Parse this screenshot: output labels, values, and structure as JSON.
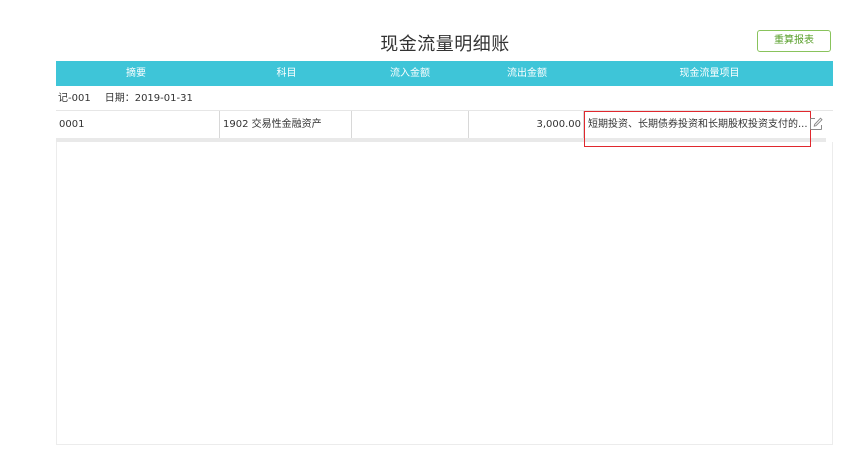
{
  "page": {
    "title": "现金流量明细账",
    "recalc_button": "重算报表"
  },
  "table": {
    "columns": [
      "摘要",
      "科目",
      "流入金额",
      "流出金额",
      "现金流量项目"
    ],
    "voucher": {
      "number": "记-001",
      "date": "日期：2019-01-31"
    },
    "rows": [
      {
        "summary": "0001",
        "account": "1902 交易性金融资产",
        "inflow": "",
        "outflow": "3,000.00",
        "cashflow_item": "短期投资、长期债券投资和长期股权投资支付的..."
      }
    ]
  },
  "icons": {
    "edit": "edit-icon"
  },
  "colors": {
    "header": "#3ec5d8",
    "button_border": "#89c35c",
    "highlight": "#e0282e"
  }
}
